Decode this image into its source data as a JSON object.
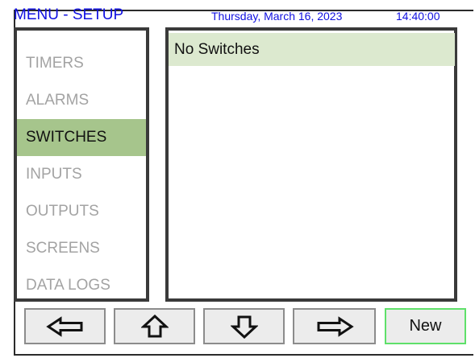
{
  "header": {
    "title": "MENU - SETUP",
    "date": "Thursday, March 16, 2023",
    "time": "14:40:00"
  },
  "menu": {
    "items": [
      {
        "label": "TIMERS",
        "active": false
      },
      {
        "label": "ALARMS",
        "active": false
      },
      {
        "label": "SWITCHES",
        "active": true
      },
      {
        "label": "INPUTS",
        "active": false
      },
      {
        "label": "OUTPUTS",
        "active": false
      },
      {
        "label": "SCREENS",
        "active": false
      },
      {
        "label": "DATA LOGS",
        "active": false
      }
    ]
  },
  "list": {
    "rows": [
      "No Switches"
    ]
  },
  "toolbar": {
    "buttons": [
      {
        "icon": "arrow-left-icon"
      },
      {
        "icon": "arrow-up-icon"
      },
      {
        "icon": "arrow-down-icon"
      },
      {
        "icon": "arrow-right-icon"
      }
    ],
    "new_label": "New"
  },
  "colors": {
    "header_text": "#1010e0",
    "active_item_bg": "#a6c58c",
    "list_row_bg": "#dce9cf",
    "new_button_border": "#5fe06a"
  }
}
